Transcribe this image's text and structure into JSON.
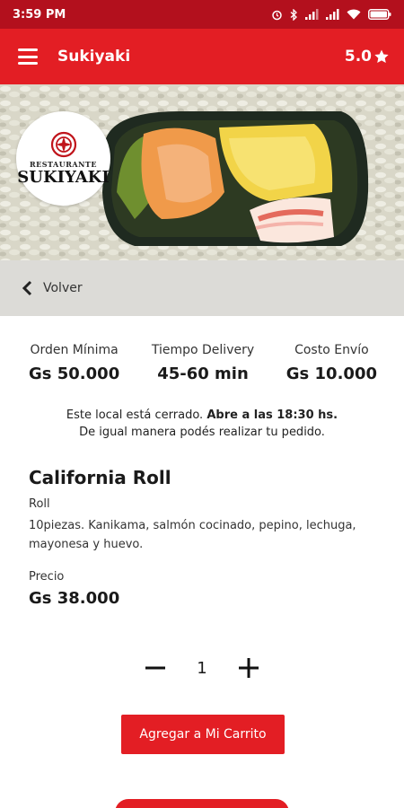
{
  "status_bar": {
    "time": "3:59 PM",
    "icons": [
      "alarm-icon",
      "bluetooth-icon",
      "signal-icon",
      "signal-icon",
      "wifi-icon",
      "battery-icon"
    ]
  },
  "app_bar": {
    "title": "Sukiyaki",
    "rating": "5.0",
    "rating_icon": "star-icon",
    "menu_icon": "hamburger-menu-icon"
  },
  "logo": {
    "small_text": "RESTAURANTE",
    "big_text": "SUKIYAKI"
  },
  "back": {
    "label": "Volver",
    "icon": "chevron-left-icon"
  },
  "info": [
    {
      "label": "Orden Mínima",
      "value": "Gs 50.000"
    },
    {
      "label": "Tiempo Delivery",
      "value": "45-60 min"
    },
    {
      "label": "Costo Envío",
      "value": "Gs 10.000"
    }
  ],
  "notice": {
    "line1_plain": "Este local está cerrado. ",
    "line1_bold": "Abre a las 18:30 hs.",
    "line2": "De igual manera podés realizar tu pedido."
  },
  "product": {
    "name": "California Roll",
    "category": "Roll",
    "description": "10piezas. Kanikama, salmón cocinado, pepino, lechuga, mayonesa y huevo.",
    "price_label": "Precio",
    "price": "Gs 38.000"
  },
  "quantity": {
    "value": "1",
    "decrement_icon": "minus-icon",
    "increment_icon": "plus-icon"
  },
  "actions": {
    "add_to_cart": "Agregar a Mi Carrito"
  },
  "colors": {
    "brand_red": "#e31e24",
    "status_bar": "#b3101d",
    "back_bar": "#dcdbd7"
  }
}
